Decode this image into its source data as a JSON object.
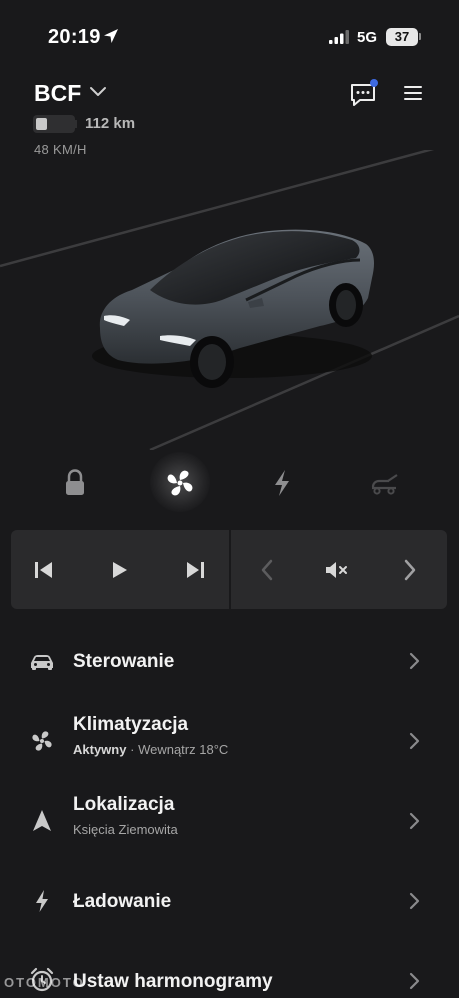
{
  "status_bar": {
    "time": "20:19",
    "network": "5G",
    "battery": "37"
  },
  "header": {
    "car_name": "BCF",
    "range": "112 km",
    "speed": "48 KM/H",
    "battery_level_fraction": 0.3,
    "has_notification": true
  },
  "quick_controls": [
    {
      "name": "lock-icon",
      "state": "inactive"
    },
    {
      "name": "fan-icon",
      "state": "active"
    },
    {
      "name": "bolt-icon",
      "state": "inactive"
    },
    {
      "name": "frunk-icon",
      "state": "disabled"
    }
  ],
  "media": {
    "controls": [
      "previous-track-icon",
      "play-icon",
      "next-track-icon",
      "source-previous-icon",
      "mute-icon",
      "source-next-icon"
    ]
  },
  "menu": {
    "controls": {
      "title": "Sterowanie"
    },
    "climate": {
      "title": "Klimatyzacja",
      "status": "Aktywny",
      "separator": "·",
      "detail": "Wewnątrz 18°C"
    },
    "location": {
      "title": "Lokalizacja",
      "detail": "Księcia Ziemowita"
    },
    "charging": {
      "title": "Ładowanie"
    },
    "schedule": {
      "title": "Ustaw harmonogramy"
    }
  },
  "watermark": "OTOMOTO",
  "colors": {
    "background": "#19191b",
    "panel": "#2a2a2c",
    "accent_dot": "#3e6ae1",
    "text_primary": "#f2f2f2",
    "text_secondary": "#a6a6a6"
  }
}
